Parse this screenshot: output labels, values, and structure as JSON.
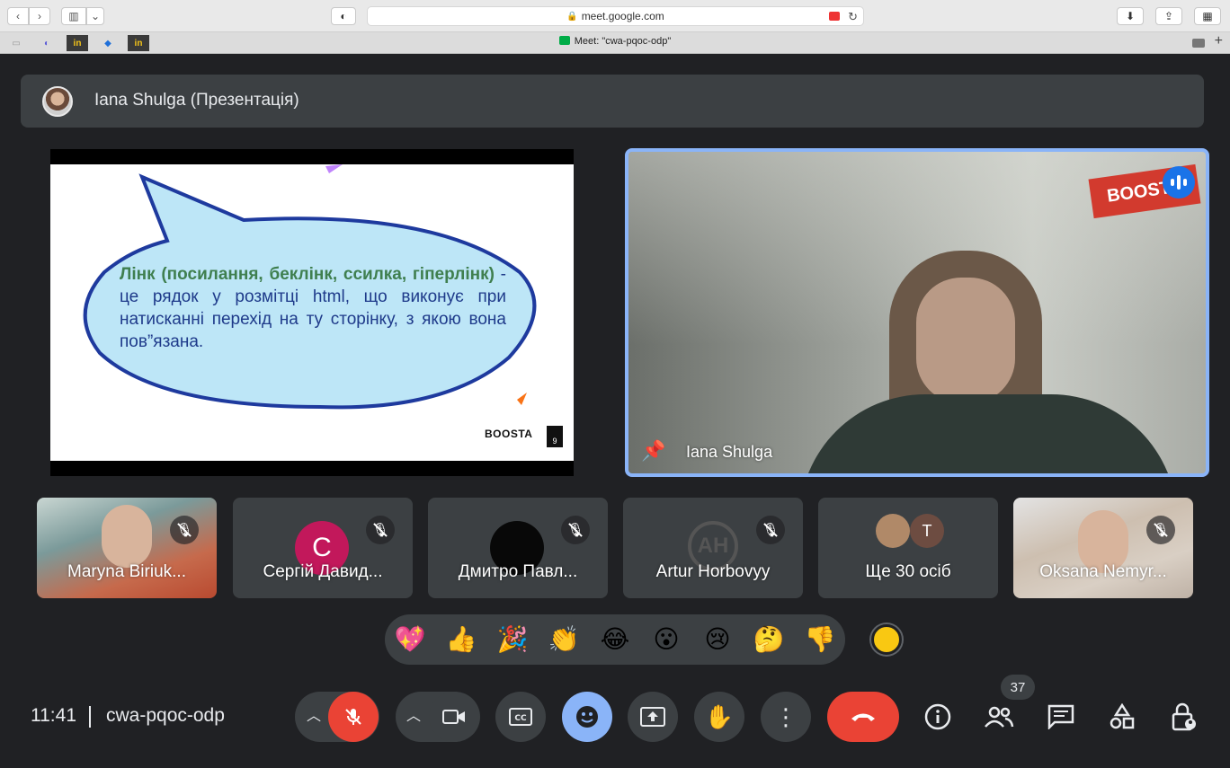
{
  "browser": {
    "url": "meet.google.com",
    "tab_title": "Meet: \"cwa-pqoc-odp\""
  },
  "presentation": {
    "header": "Iana Shulga (Презентація)",
    "slide_text_strong": "Лінк (посилання, беклінк, ссилка, гіперлінк)",
    "slide_text_rest": " - це рядок у розмітці html, що виконує при натисканні перехід на ту сторінку, з якою вона пов”язана.",
    "logo": "BOOSTA",
    "page_number": "9"
  },
  "speaker": {
    "name": "Iana Shulga",
    "sign": "BOOSTA"
  },
  "participants": [
    {
      "name": "Maryna Biriuk..."
    },
    {
      "name": "Сергій Давид...",
      "initial": "C"
    },
    {
      "name": "Дмитро Павл..."
    },
    {
      "name": "Artur Horbovyy",
      "initial": "AH"
    },
    {
      "name": "Ще 30 осіб",
      "initial": "T"
    },
    {
      "name": "Oksana Nemyr..."
    }
  ],
  "reactions": [
    "💖",
    "👍",
    "🎉",
    "👏",
    "😂",
    "😮",
    "😢",
    "🤔",
    "👎"
  ],
  "colors": {
    "background": "#202124",
    "surface": "#3c4043",
    "hangup_red": "#ea4335",
    "accent_blue": "#8ab4f8",
    "avatar_magenta": "#c2185b"
  },
  "controls": {
    "time": "11:41",
    "meeting_code": "cwa-pqoc-odp",
    "people_count": "37"
  }
}
